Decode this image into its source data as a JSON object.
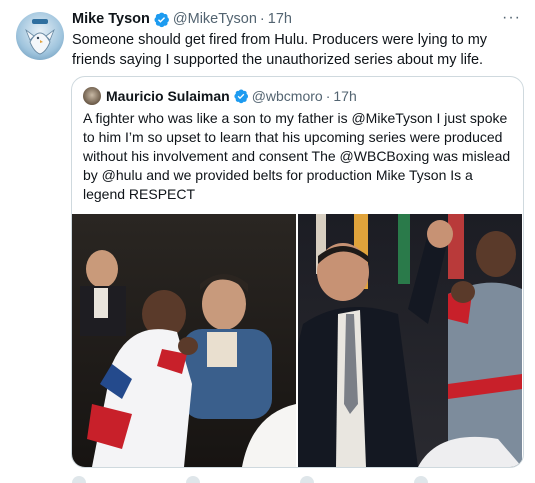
{
  "tweet": {
    "author_name": "Mike Tyson",
    "author_handle": "@MikeTyson",
    "separator": "·",
    "time": "17h",
    "more_label": "···",
    "text": "Someone should get fired from Hulu. Producers were lying to my friends saying I supported the unauthorized series about my life.",
    "verified_icon": "verified-badge-icon",
    "accent_color": "#1d9bf0"
  },
  "quoted": {
    "author_name": "Mauricio Sulaiman",
    "author_handle": "@wbcmoro",
    "separator": "·",
    "time": "17h",
    "text": "A fighter who was like a son to my father is @MikeTyson I just spoke to him I’m so upset to learn that his upcoming series were produced without his involvement and consent The @WBCBoxing was mislead by @hulu and we provided belts for production Mike Tyson  Is a legend RESPECT",
    "photos": [
      "photo-1",
      "photo-2"
    ]
  }
}
